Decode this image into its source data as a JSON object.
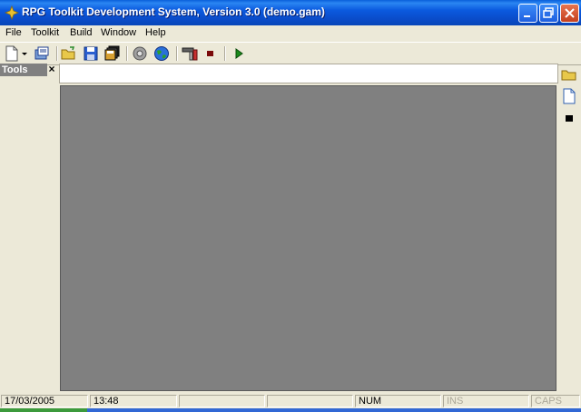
{
  "window": {
    "title": "RPG Toolkit Development System, Version 3.0 (demo.gam)"
  },
  "menu": [
    "File",
    "Toolkit",
    "Build",
    "Window",
    "Help"
  ],
  "toolbar": {
    "tools": [
      "new-document-icon",
      "dropdown-arrow-icon",
      "open-project-icon",
      "open-folder-icon",
      "save-icon",
      "save-all-icon",
      "test-run-icon",
      "web-globe-icon",
      "configuration-icon",
      "stop-icon",
      "play-icon"
    ]
  },
  "tools_panel": {
    "title": "Tools",
    "close_glyph": "×"
  },
  "right_tools": [
    "open-folder-icon",
    "new-page-icon",
    "stop-square-icon"
  ],
  "status": {
    "date": "17/03/2005",
    "time": "13:48",
    "empty1": "",
    "empty2": "",
    "num": "NUM",
    "ins": "INS",
    "caps": "CAPS"
  },
  "colors": {
    "titlebar": "#0A4CC9",
    "chrome": "#ECE9D8",
    "workspace": "#808080"
  }
}
